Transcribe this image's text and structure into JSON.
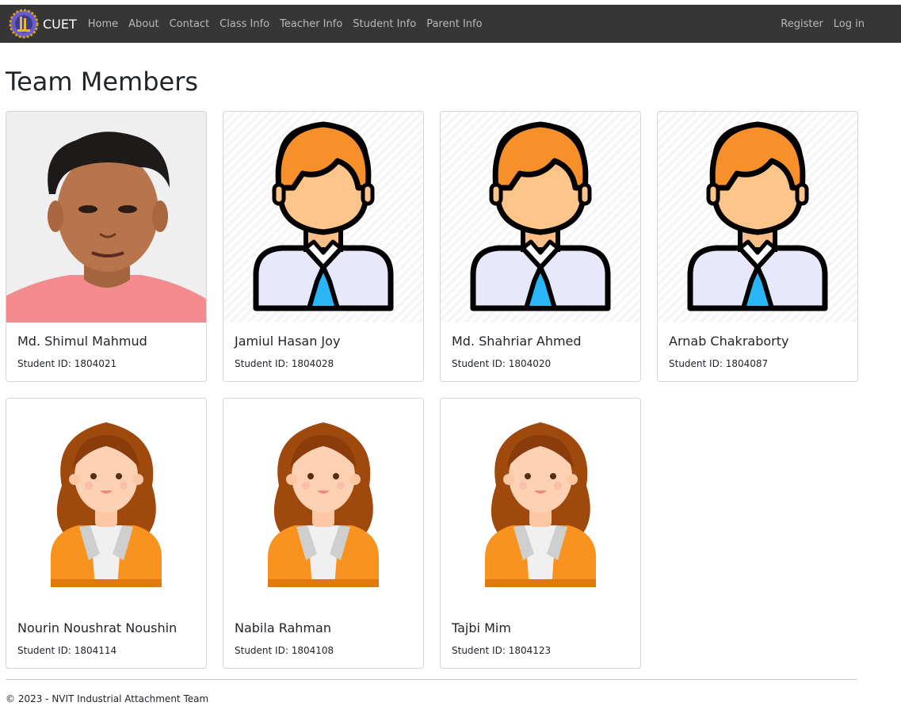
{
  "brand": {
    "logo_icon": "cuet-logo-icon",
    "name": "CUET"
  },
  "nav": {
    "items": [
      "Home",
      "About",
      "Contact",
      "Class Info",
      "Teacher Info",
      "Student Info",
      "Parent Info"
    ],
    "right": [
      "Register",
      "Log in"
    ]
  },
  "page": {
    "title": "Team Members"
  },
  "members": [
    {
      "name": "Md. Shimul Mahmud",
      "id_text": "Student ID: 1804021",
      "avatar": "photo"
    },
    {
      "name": "Jamiul Hasan Joy",
      "id_text": "Student ID: 1804028",
      "avatar": "male-avatar-icon"
    },
    {
      "name": "Md. Shahriar Ahmed",
      "id_text": "Student ID: 1804020",
      "avatar": "male-avatar-icon"
    },
    {
      "name": "Arnab Chakraborty",
      "id_text": "Student ID: 1804087",
      "avatar": "male-avatar-icon"
    },
    {
      "name": "Nourin Noushrat Noushin",
      "id_text": "Student ID: 1804114",
      "avatar": "female-avatar-icon"
    },
    {
      "name": "Nabila Rahman",
      "id_text": "Student ID: 1804108",
      "avatar": "female-avatar-icon"
    },
    {
      "name": "Tajbi Mim",
      "id_text": "Student ID: 1804123",
      "avatar": "female-avatar-icon"
    }
  ],
  "footer": {
    "text": "© 2023 - NVIT Industrial Attachment Team"
  },
  "colors": {
    "navbar": "#363636",
    "nav_link": "#b9b9b9",
    "male_hair": "#f7902a",
    "female_jacket": "#f7931e",
    "tie": "#29b6f6"
  }
}
